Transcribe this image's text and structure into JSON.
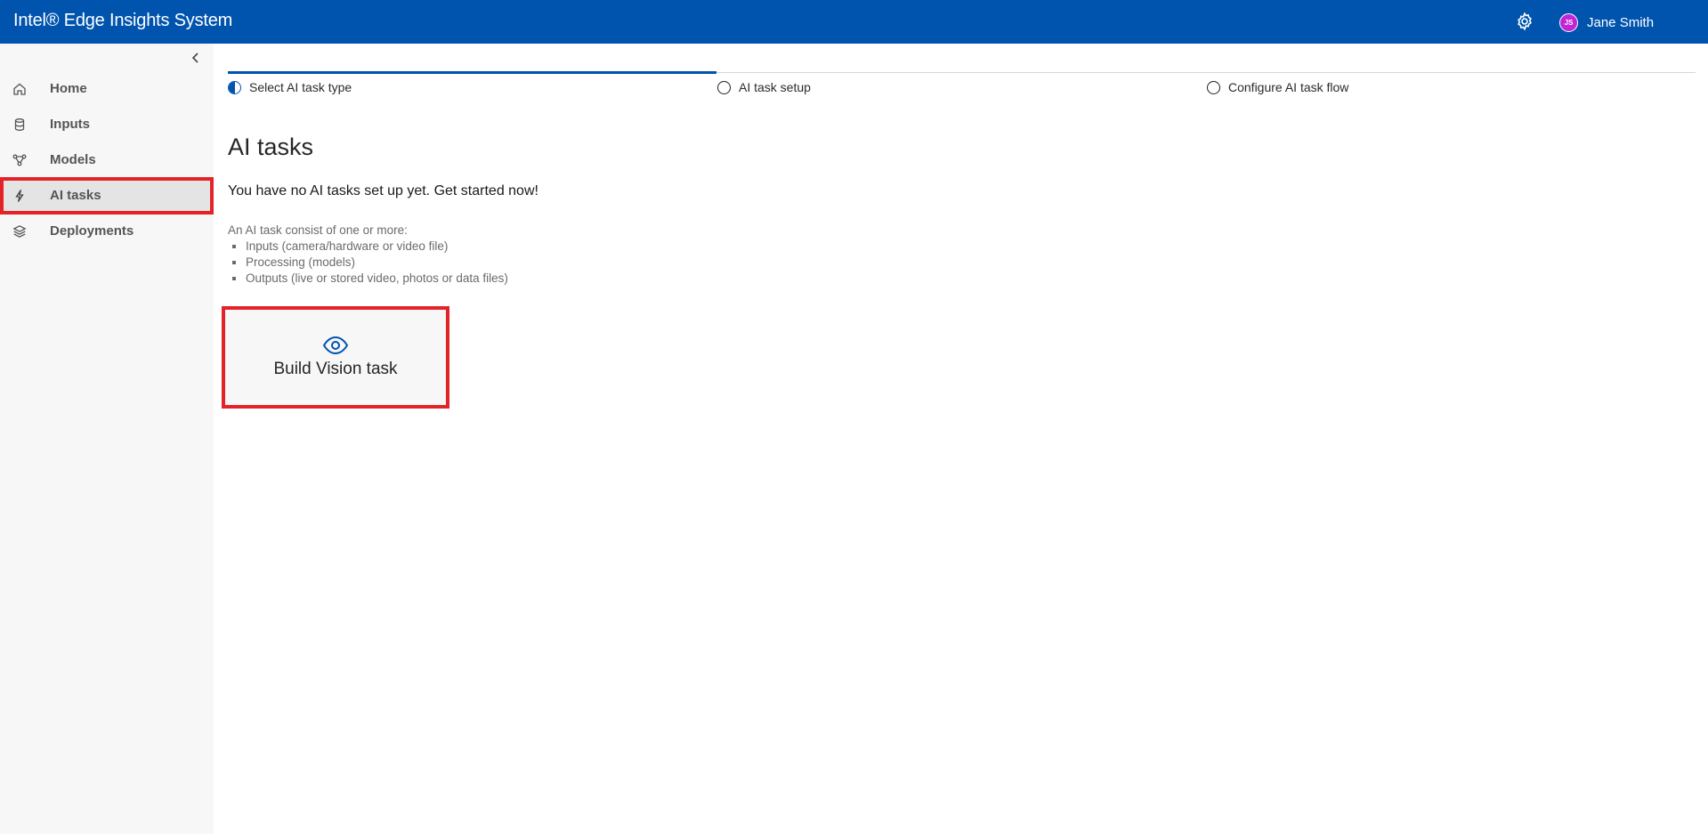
{
  "header": {
    "app_title": "Intel® Edge Insights System",
    "settings_icon": "gear-icon",
    "user": {
      "initials": "JS",
      "name": "Jane Smith"
    }
  },
  "sidebar": {
    "collapse_icon": "chevron-left-icon",
    "items": [
      {
        "label": "Home",
        "icon": "home-icon",
        "active": false
      },
      {
        "label": "Inputs",
        "icon": "database-icon",
        "active": false
      },
      {
        "label": "Models",
        "icon": "network-icon",
        "active": false
      },
      {
        "label": "AI tasks",
        "icon": "lightning-icon",
        "active": true
      },
      {
        "label": "Deployments",
        "icon": "layers-icon",
        "active": false
      }
    ]
  },
  "stepper": {
    "steps": [
      {
        "label": "Select AI task type",
        "state": "current"
      },
      {
        "label": "AI task setup",
        "state": "pending"
      },
      {
        "label": "Configure AI task flow",
        "state": "pending"
      }
    ]
  },
  "main": {
    "title": "AI tasks",
    "empty_message": "You have no AI tasks set up yet. Get started now!",
    "info_intro": "An AI task consist of one or more:",
    "info_items": [
      "Inputs (camera/hardware or video file)",
      "Processing (models)",
      "Outputs (live or stored video, photos or data files)"
    ],
    "build_card": {
      "icon": "eye-icon",
      "label": "Build Vision task"
    }
  },
  "colors": {
    "brand_blue": "#0054ae",
    "highlight_red": "#e42329",
    "avatar_purple": "#c126d6",
    "sidebar_bg": "#f7f7f7"
  }
}
